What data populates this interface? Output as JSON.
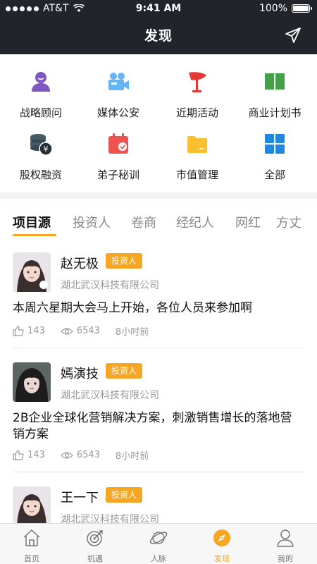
{
  "status": {
    "carrier": "AT&T",
    "time": "9:41 AM",
    "battery": "100%"
  },
  "nav": {
    "title": "发现"
  },
  "grid": [
    {
      "label": "战略顾问",
      "icon": "advisor-icon",
      "color": "#7e57c2"
    },
    {
      "label": "媒体公安",
      "icon": "video-camera-icon",
      "color": "#64b5f6"
    },
    {
      "label": "近期活动",
      "icon": "flag-icon",
      "color": "#e53935"
    },
    {
      "label": "商业计划书",
      "icon": "book-icon",
      "color": "#43a047"
    },
    {
      "label": "股权融资",
      "icon": "coins-icon",
      "color": "#455a64"
    },
    {
      "label": "弟子秘训",
      "icon": "calendar-check-icon",
      "color": "#ef5350"
    },
    {
      "label": "市值管理",
      "icon": "folder-icon",
      "color": "#fbc02d"
    },
    {
      "label": "全部",
      "icon": "grid-icon",
      "color": "#1e88e5"
    }
  ],
  "tabs": [
    "项目源",
    "投资人",
    "卷商",
    "经纪人",
    "网红",
    "方丈"
  ],
  "active_tab": 0,
  "posts": [
    {
      "name": "赵无极",
      "badge": "投资人",
      "company": "湖北武汉科技有限公司",
      "content": "本周六星期大会马上开始，各位人员来参加啊",
      "likes": "143",
      "views": "6543",
      "time": "8小时前"
    },
    {
      "name": "嫣演技",
      "badge": "投资人",
      "company": "湖北武汉科技有限公司",
      "content": "2B企业全球化营销解决方案，刺激销售增长的落地营销方案",
      "likes": "143",
      "views": "6543",
      "time": "8小时前"
    },
    {
      "name": "王一下",
      "badge": "投资人",
      "company": "湖北武汉科技有限公司",
      "content": "",
      "likes": "",
      "views": "",
      "time": ""
    }
  ],
  "tabbar": [
    {
      "label": "首页",
      "icon": "home-icon"
    },
    {
      "label": "机遇",
      "icon": "target-icon"
    },
    {
      "label": "人脉",
      "icon": "planet-icon"
    },
    {
      "label": "发现",
      "icon": "compass-icon"
    },
    {
      "label": "我的",
      "icon": "person-icon"
    }
  ],
  "active_tabbar": 3,
  "colors": {
    "accent": "#f5a623",
    "header": "#23232b"
  }
}
